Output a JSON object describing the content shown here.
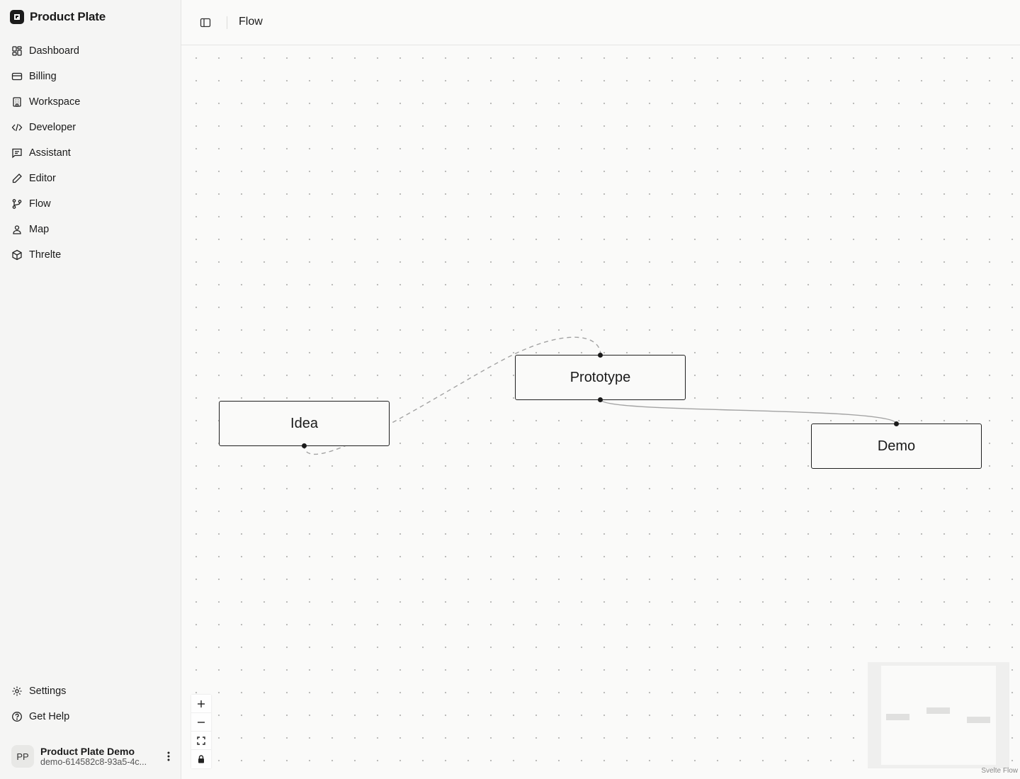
{
  "app": {
    "name": "Product Plate"
  },
  "sidebar": {
    "items": [
      {
        "label": "Dashboard",
        "icon": "dashboard-icon"
      },
      {
        "label": "Billing",
        "icon": "credit-card-icon"
      },
      {
        "label": "Workspace",
        "icon": "building-icon"
      },
      {
        "label": "Developer",
        "icon": "code-icon"
      },
      {
        "label": "Assistant",
        "icon": "message-square-icon"
      },
      {
        "label": "Editor",
        "icon": "pencil-icon"
      },
      {
        "label": "Flow",
        "icon": "git-branch-icon"
      },
      {
        "label": "Map",
        "icon": "map-pin-user-icon"
      },
      {
        "label": "Threlte",
        "icon": "box-icon"
      }
    ],
    "bottom_items": [
      {
        "label": "Settings",
        "icon": "gear-icon"
      },
      {
        "label": "Get Help",
        "icon": "help-circle-icon"
      }
    ]
  },
  "user": {
    "initials": "PP",
    "name": "Product Plate Demo",
    "id": "demo-614582c8-93a5-4c..."
  },
  "header": {
    "title": "Flow"
  },
  "flow": {
    "nodes": [
      {
        "id": "idea",
        "label": "Idea"
      },
      {
        "id": "prototype",
        "label": "Prototype"
      },
      {
        "id": "demo",
        "label": "Demo"
      }
    ],
    "edges": [
      {
        "from": "Idea",
        "to": "Prototype",
        "style": "dashed"
      },
      {
        "from": "Prototype",
        "to": "Demo",
        "style": "solid"
      }
    ],
    "controls": [
      "zoom-in-icon",
      "zoom-out-icon",
      "fit-view-icon",
      "lock-icon"
    ],
    "attribution": "Svelte Flow"
  }
}
